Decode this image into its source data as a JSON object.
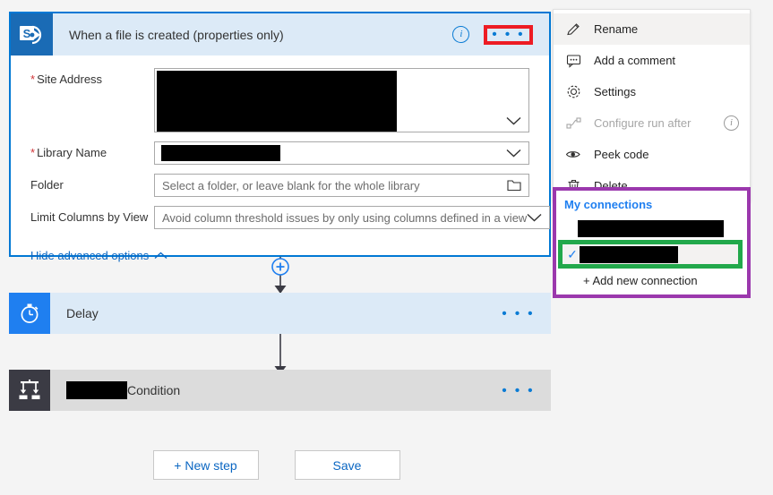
{
  "trigger": {
    "title": "When a file is created (properties only)",
    "icon": "sharepoint-icon",
    "info_icon": "i",
    "ellipsis": "• • •",
    "fields": [
      {
        "label": "Site Address",
        "required": true,
        "value": "",
        "redacted": true,
        "placeholder": ""
      },
      {
        "label": "Library Name",
        "required": true,
        "value": "",
        "redacted": true,
        "placeholder": ""
      },
      {
        "label": "Folder",
        "required": false,
        "value": "",
        "redacted": false,
        "placeholder": "Select a folder, or leave blank for the whole library"
      },
      {
        "label": "Limit Columns by View",
        "required": false,
        "value": "",
        "redacted": false,
        "placeholder": "Avoid column threshold issues by only using columns defined in a view"
      }
    ],
    "advanced_link": "Hide advanced options"
  },
  "steps": [
    {
      "title": "Delay",
      "icon": "stopwatch-icon",
      "redacted_prefix": false,
      "ellipsis": "• • •"
    },
    {
      "title": "Condition",
      "icon": "condition-branch-icon",
      "redacted_prefix": true,
      "ellipsis": "• • •"
    }
  ],
  "buttons": {
    "new_step": "+ New step",
    "save": "Save"
  },
  "context_menu": {
    "items": [
      {
        "label": "Rename",
        "icon": "pencil-icon",
        "selected": true,
        "disabled": false,
        "info": false
      },
      {
        "label": "Add a comment",
        "icon": "comment-icon",
        "selected": false,
        "disabled": false,
        "info": false
      },
      {
        "label": "Settings",
        "icon": "gear-icon",
        "selected": false,
        "disabled": false,
        "info": false
      },
      {
        "label": "Configure run after",
        "icon": "run-after-icon",
        "selected": false,
        "disabled": true,
        "info": true
      },
      {
        "label": "Peek code",
        "icon": "eye-icon",
        "selected": false,
        "disabled": false,
        "info": false
      },
      {
        "label": "Delete",
        "icon": "trash-icon",
        "selected": false,
        "disabled": false,
        "info": false
      }
    ],
    "info_glyph": "i"
  },
  "connections": {
    "title": "My connections",
    "rows": [
      {
        "redacted": true,
        "selected": false
      },
      {
        "redacted": true,
        "selected": true,
        "check": "✓"
      }
    ],
    "add_label": "+ Add new connection"
  },
  "highlights": {
    "ellipsis_box_color": "#ed1c24",
    "connections_box_color": "#9b38ad",
    "selected_connection_box_color": "#22a84b"
  },
  "colors": {
    "accent_blue": "#0078d4",
    "header_fill": "#dceaf7",
    "sharepoint_blue": "#1a6bb5",
    "delay_blue": "#1f7ff0",
    "condition_gray": "#3b3b44",
    "condition_bar": "#dcdcdc",
    "canvas_bg": "#f4f4f4"
  }
}
